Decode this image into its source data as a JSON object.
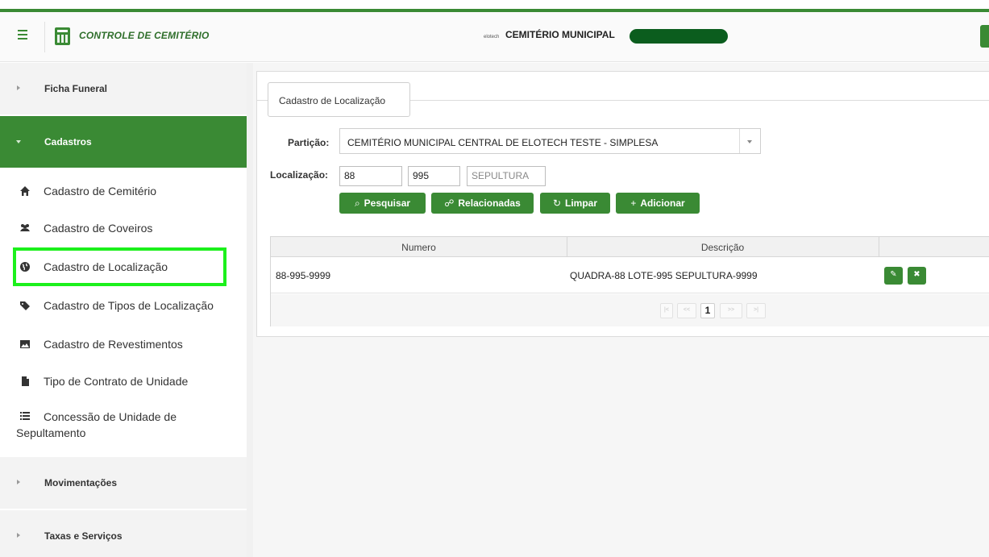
{
  "header": {
    "app_title": "CONTROLE DE CEMITÉRIO",
    "org_small": "elotech",
    "org_name": "CEMITÉRIO MUNICIPAL"
  },
  "sidebar": {
    "sections": [
      {
        "label": "Ficha Funeral"
      },
      {
        "label": "Cadastros"
      },
      {
        "label": "Movimentações"
      },
      {
        "label": "Taxas e Serviços"
      }
    ],
    "items": [
      {
        "label": "Cadastro de Cemitério",
        "icon": "home-icon"
      },
      {
        "label": "Cadastro de Coveiros",
        "icon": "users-icon"
      },
      {
        "label": "Cadastro de Localização",
        "icon": "globe-icon"
      },
      {
        "label": "Cadastro de Tipos de Localização",
        "icon": "tag-icon"
      },
      {
        "label": "Cadastro de Revestimentos",
        "icon": "image-icon"
      },
      {
        "label": "Tipo de Contrato de Unidade",
        "icon": "file-icon"
      },
      {
        "label": "Concessão de Unidade de",
        "label2": "Sepultamento",
        "icon": "list-icon"
      }
    ]
  },
  "form": {
    "legend": "Cadastro de Localização",
    "particao_label": "Partição:",
    "particao_value": "CEMITÉRIO MUNICIPAL CENTRAL DE ELOTECH TESTE - SIMPLESA",
    "localizacao_label": "Localização:",
    "loc1": "88",
    "loc2": "995",
    "loc3": "SEPULTURA",
    "buttons": {
      "pesquisar": "Pesquisar",
      "relacionadas": "Relacionadas",
      "limpar": "Limpar",
      "adicionar": "Adicionar"
    }
  },
  "grid": {
    "columns": [
      "Numero",
      "Descrição",
      ""
    ],
    "rows": [
      {
        "numero": "88-995-9999",
        "descricao": "QUADRA-88 LOTE-995 SEPULTURA-9999"
      }
    ],
    "pager": {
      "current_page": "1"
    }
  },
  "colors": {
    "accent": "#3a8a34",
    "highlight": "#1cf01c"
  }
}
